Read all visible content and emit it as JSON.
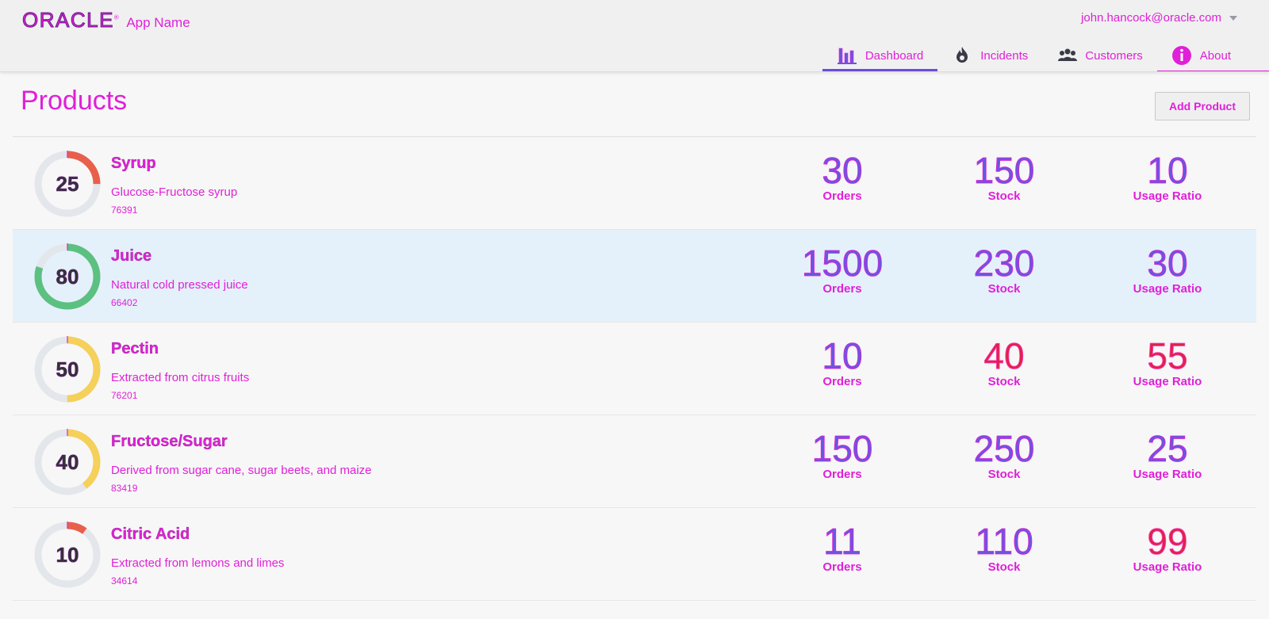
{
  "header": {
    "logo": "ORACLE",
    "app_name": "App Name",
    "user": "john.hancock@oracle.com",
    "nav": [
      {
        "label": "Dashboard",
        "icon": "bar-chart-icon"
      },
      {
        "label": "Incidents",
        "icon": "flame-icon"
      },
      {
        "label": "Customers",
        "icon": "people-icon"
      },
      {
        "label": "About",
        "icon": "info-icon"
      }
    ]
  },
  "page": {
    "title": "Products",
    "add_button": "Add Product"
  },
  "labels": {
    "orders": "Orders",
    "stock": "Stock",
    "ratio": "Usage Ratio"
  },
  "colors": {
    "red": "#e8604c",
    "green": "#5cc081",
    "yellow": "#f5d05a",
    "track": "#e3e6ea",
    "purple": "#6b55e0",
    "alert": "#e0224a"
  },
  "products": [
    {
      "name": "Syrup",
      "description": "Glucose-Fructose syrup",
      "id": "76391",
      "gauge": 25,
      "gauge_color": "#e8604c",
      "orders": "30",
      "stock": "150",
      "ratio": "10",
      "orders_alert": false,
      "stock_alert": false,
      "ratio_alert": false
    },
    {
      "name": "Juice",
      "description": "Natural cold pressed juice",
      "id": "66402",
      "gauge": 80,
      "gauge_color": "#5cc081",
      "orders": "1500",
      "stock": "230",
      "ratio": "30",
      "orders_alert": false,
      "stock_alert": false,
      "ratio_alert": false,
      "selected": true
    },
    {
      "name": "Pectin",
      "description": "Extracted from citrus fruits",
      "id": "76201",
      "gauge": 50,
      "gauge_color": "#f5d05a",
      "orders": "10",
      "stock": "40",
      "ratio": "55",
      "orders_alert": false,
      "stock_alert": true,
      "ratio_alert": true
    },
    {
      "name": "Fructose/Sugar",
      "description": "Derived from sugar cane, sugar beets, and maize",
      "id": "83419",
      "gauge": 40,
      "gauge_color": "#f5d05a",
      "orders": "150",
      "stock": "250",
      "ratio": "25",
      "orders_alert": false,
      "stock_alert": false,
      "ratio_alert": false
    },
    {
      "name": "Citric Acid",
      "description": "Extracted from lemons and limes",
      "id": "34614",
      "gauge": 10,
      "gauge_color": "#e8604c",
      "orders": "11",
      "stock": "110",
      "ratio": "99",
      "orders_alert": false,
      "stock_alert": false,
      "ratio_alert": true
    }
  ]
}
